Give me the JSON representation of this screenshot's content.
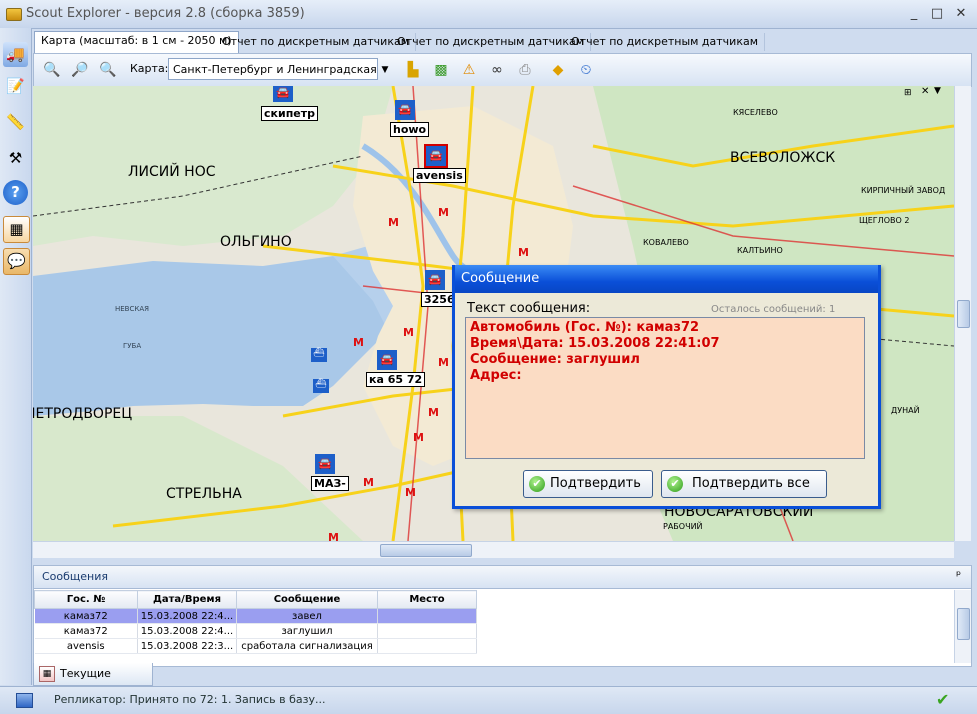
{
  "window": {
    "title": "Scout Explorer - версия 2.8 (сборка 3859)",
    "min": "_",
    "max": "□",
    "close": "✕"
  },
  "left_toolbar": {
    "icons": [
      "vehicles-icon",
      "edit-icon",
      "ruler-icon",
      "tools-icon",
      "help-icon",
      "calendar-icon",
      "messages-icon"
    ]
  },
  "tabs": [
    {
      "label": "Карта (масштаб: в 1 см - 2050 м)",
      "active": true
    },
    {
      "label": "Отчет по дискретным датчикам",
      "active": false
    },
    {
      "label": "Отчет по дискретным датчикам",
      "active": false
    },
    {
      "label": "Отчет по дискретным датчикам",
      "active": false
    }
  ],
  "map_toolbar": {
    "map_label": "Карта:",
    "map_value": "Санкт-Петербург и Ленинградская"
  },
  "map": {
    "places": [
      {
        "name": "ЛИСИЙ НОС",
        "big": true
      },
      {
        "name": "ОЛЬГИНО",
        "big": true
      },
      {
        "name": "ПЕТРОДВОРЕЦ",
        "big": true
      },
      {
        "name": "СТРЕЛЬНА",
        "big": true
      },
      {
        "name": "ВСЕВОЛОЖСК",
        "big": true
      },
      {
        "name": "НОВОСАРАТОВСКИЙ",
        "big": true
      },
      {
        "name": "КЯСЕЛЕВО",
        "big": false
      },
      {
        "name": "КИРПИЧНЫЙ ЗАВОД",
        "big": false
      },
      {
        "name": "ЩЕГЛОВО 2",
        "big": false
      },
      {
        "name": "КОВАЛЕВО",
        "big": false
      },
      {
        "name": "КАЛТЬИНО",
        "big": false
      },
      {
        "name": "ДУНАЙ",
        "big": false
      },
      {
        "name": "РАБОЧИЙ",
        "big": false
      },
      {
        "name": "НЕВСКАЯ",
        "big": false
      },
      {
        "name": "ГУБА",
        "big": false
      }
    ],
    "vehicles": [
      "скипетр",
      "howo",
      "avensis",
      "3256",
      "ка 65 72",
      "МАЗ-"
    ]
  },
  "dialog": {
    "title": "Сообщение",
    "text_label": "Текст сообщения:",
    "remaining": "Осталось сообщений: 1",
    "lines": [
      "Автомобиль (Гос. №): камаз72",
      "Время\\Дата: 15.03.2008 22:41:07",
      "Сообщение: заглушил",
      "Адрес:"
    ],
    "confirm_label": "Подтвердить",
    "confirm_all_label": "Подтвердить все"
  },
  "messages_panel": {
    "title": "Сообщения",
    "pin": "ᵖ",
    "columns": [
      "Гос. №",
      "Дата/Время",
      "Сообщение",
      "Место"
    ],
    "rows": [
      {
        "plate": "камаз72",
        "datetime": "15.03.2008 22:4...",
        "message": "завел",
        "place": "",
        "selected": true
      },
      {
        "plate": "камаз72",
        "datetime": "15.03.2008 22:4...",
        "message": "заглушил",
        "place": "",
        "selected": false
      },
      {
        "plate": "avensis",
        "datetime": "15.03.2008 22:3...",
        "message": "сработала сигнализация",
        "place": "",
        "selected": false
      }
    ]
  },
  "bottom_tab": {
    "label": "Текущие данные"
  },
  "status": {
    "text": "Репликатор: Принято по 72: 1. Запись в базу...",
    "ok": "✔"
  },
  "colors": {
    "accent": "#0a4fd8",
    "selected_row": "#9a9ef0",
    "message_text": "#d10000",
    "message_bg": "#fbdcc4"
  }
}
